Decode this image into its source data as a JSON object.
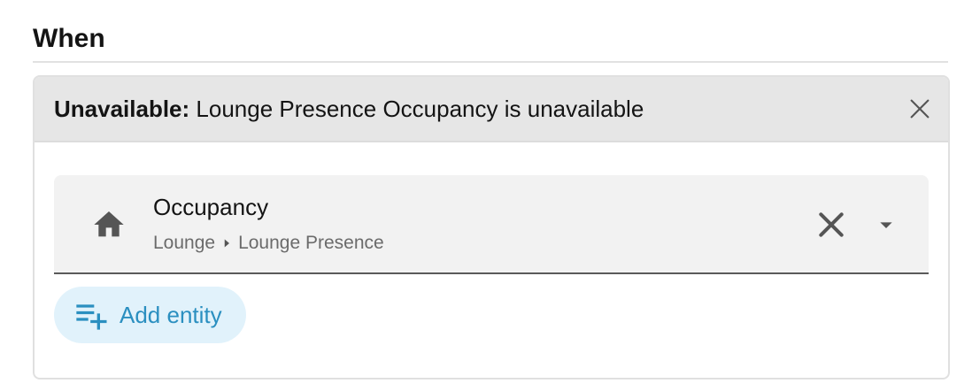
{
  "section": {
    "title": "When"
  },
  "trigger": {
    "kind_label": "Unavailable:",
    "summary": "Lounge Presence Occupancy is unavailable",
    "close_icon": "close-icon"
  },
  "entity": {
    "icon": "home-icon",
    "name": "Occupancy",
    "area": "Lounge",
    "device": "Lounge Presence",
    "path_separator_icon": "caret-right-icon",
    "clear_icon": "close-icon",
    "dropdown_icon": "caret-down-icon"
  },
  "add_entity": {
    "label": "Add entity",
    "icon": "playlist-plus-icon"
  },
  "colors": {
    "header_bg": "#e6e6e6",
    "entity_bg": "#f2f2f2",
    "accent": "#2a8fc0",
    "accent_bg": "#e1f2fb",
    "secondary_text": "#6b6b6b"
  }
}
